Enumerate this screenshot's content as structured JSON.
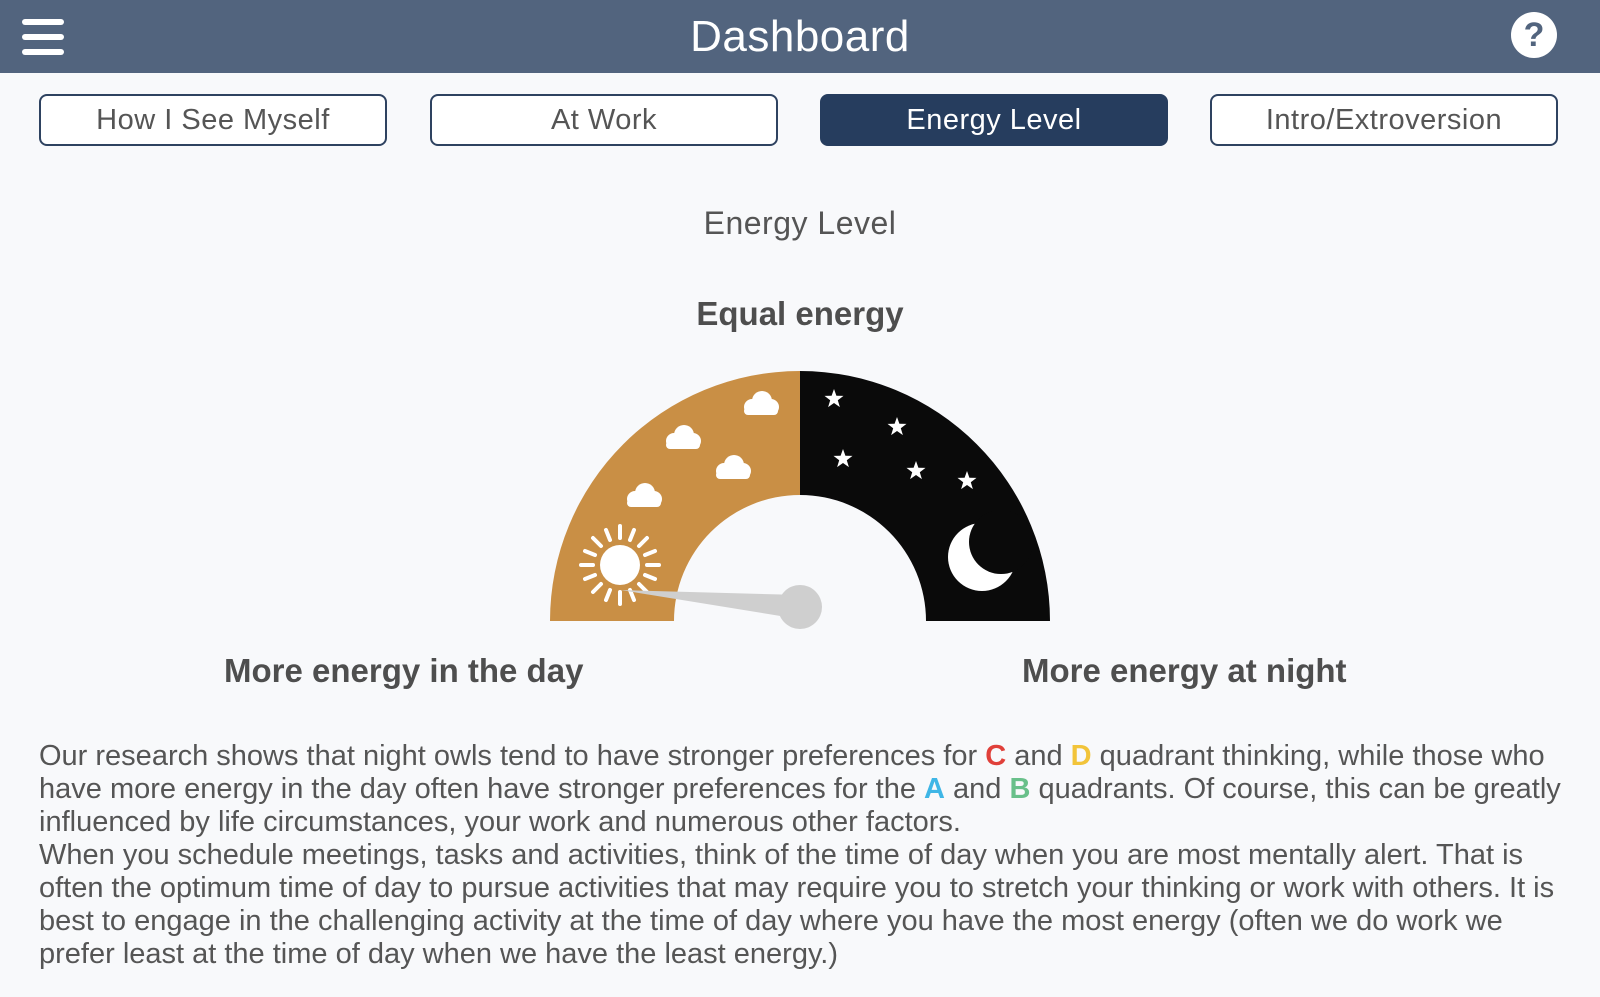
{
  "header": {
    "title": "Dashboard",
    "menu_icon": "hamburger-menu-icon",
    "help_icon": "question-mark-icon",
    "help_glyph": "?"
  },
  "tabs": [
    {
      "label": "How I See Myself",
      "active": false
    },
    {
      "label": "At Work",
      "active": false
    },
    {
      "label": "Energy Level",
      "active": true
    },
    {
      "label": "Intro/Extroversion",
      "active": false
    }
  ],
  "section_title": "Energy Level",
  "gauge": {
    "top_label": "Equal energy",
    "left_label": "More energy in the day",
    "right_label": "More energy at night",
    "needle_fraction": 0.03,
    "colors": {
      "day": "#c98f45",
      "night": "#0a0a0a",
      "needle": "#cfcfcf"
    }
  },
  "description": {
    "p1_a": "Our research shows that night owls tend to have stronger preferences for ",
    "q_c": "C",
    "p1_b": " and ",
    "q_d": "D",
    "p1_c": " quadrant thinking, while those who have more energy in the day often have stronger preferences for the ",
    "q_a": "A",
    "p1_d": " and ",
    "q_b": "B",
    "p1_e": " quadrants. Of course, this can be greatly influenced by life circumstances, your work and numerous other factors.",
    "p2": "When you schedule meetings, tasks and activities, think of the time of day when you are most mentally alert. That is often the optimum time of day to pursue activities that may require you to stretch your thinking or work with others. It is best to engage in the challenging activity at the time of day where you have the most energy (often we do work we prefer least at the time of day when we have the least energy.)",
    "quadrant_colors": {
      "A": "#3fb6e6",
      "B": "#69c08a",
      "C": "#e0403a",
      "D": "#f2c43a"
    }
  }
}
